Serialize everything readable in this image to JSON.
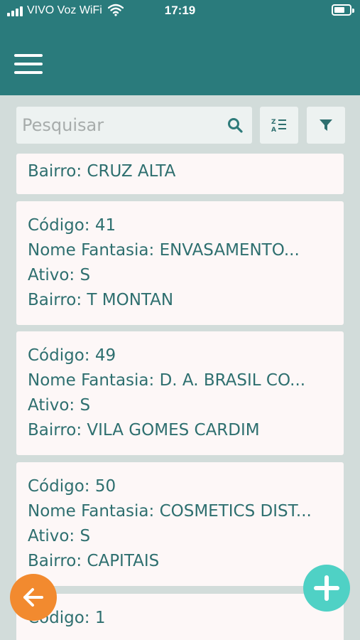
{
  "status_bar": {
    "carrier": "VIVO Voz WiFi",
    "time": "17:19"
  },
  "app_bar": {
    "menu_icon": "hamburger-menu-icon"
  },
  "search": {
    "placeholder": "Pesquisar",
    "value": "",
    "search_icon": "search-icon",
    "sort_icon": "sort-az-icon",
    "filter_icon": "filter-funnel-icon"
  },
  "records": [
    {
      "bairro": "Bairro: CRUZ ALTA"
    },
    {
      "codigo": "Código: 41",
      "nome": "Nome Fantasia: ENVASAMENTO...",
      "ativo": "Ativo: S",
      "bairro": "Bairro: T MONTAN"
    },
    {
      "codigo": "Código: 49",
      "nome": "Nome Fantasia: D. A. BRASIL CO...",
      "ativo": "Ativo: S",
      "bairro": "Bairro: VILA GOMES CARDIM"
    },
    {
      "codigo": "Código: 50",
      "nome": "Nome Fantasia: COSMETICS DIST...",
      "ativo": "Ativo: S",
      "bairro": "Bairro: CAPITAIS"
    },
    {
      "codigo": "Código: 1"
    }
  ],
  "fabs": {
    "back_icon": "arrow-left-icon",
    "add_icon": "plus-icon"
  },
  "colors": {
    "primary": "#2a7b7c",
    "background": "#d2dcda",
    "card": "#fdf7f7",
    "card_text": "#2e6f6f",
    "back_fab": "#f28a2f",
    "add_fab": "#4fd1c5"
  }
}
